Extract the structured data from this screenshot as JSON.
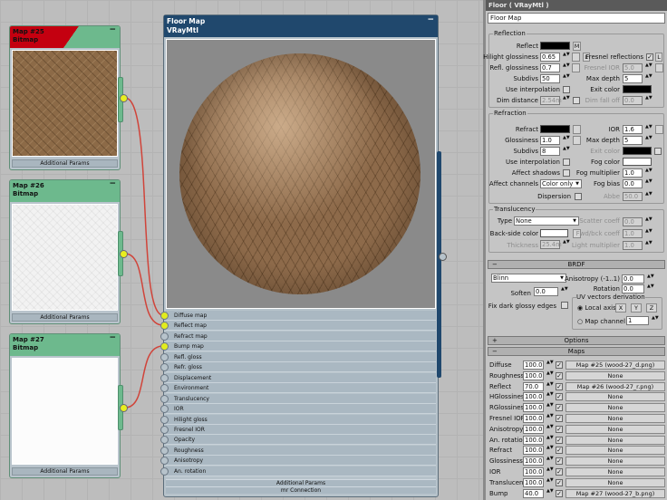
{
  "nodes": [
    {
      "title": "Map #25",
      "type": "Bitmap",
      "footer": "Additional Params",
      "selected": true,
      "texture": "wood"
    },
    {
      "title": "Map #26",
      "type": "Bitmap",
      "footer": "Additional Params",
      "selected": false,
      "texture": "white"
    },
    {
      "title": "Map #27",
      "type": "Bitmap",
      "footer": "Additional Params",
      "selected": false,
      "texture": "plain"
    }
  ],
  "material": {
    "name": "Floor Map",
    "type": "VRayMtl",
    "slots": [
      {
        "label": "Diffuse map",
        "connected": true
      },
      {
        "label": "Reflect map",
        "connected": true
      },
      {
        "label": "Refract map",
        "connected": false
      },
      {
        "label": "Bump map",
        "connected": true
      },
      {
        "label": "Refl. gloss",
        "connected": false
      },
      {
        "label": "Refr. gloss",
        "connected": false
      },
      {
        "label": "Displacement",
        "connected": false
      },
      {
        "label": "Environment",
        "connected": false
      },
      {
        "label": "Translucency",
        "connected": false
      },
      {
        "label": "IOR",
        "connected": false
      },
      {
        "label": "Hilight gloss",
        "connected": false
      },
      {
        "label": "Fresnel IOR",
        "connected": false
      },
      {
        "label": "Opacity",
        "connected": false
      },
      {
        "label": "Roughness",
        "connected": false
      },
      {
        "label": "Anisotropy",
        "connected": false
      },
      {
        "label": "An. rotation",
        "connected": false
      }
    ],
    "footer1": "Additional Params",
    "footer2": "mr Connection"
  },
  "panel": {
    "title": "Floor  ( VRayMtl )",
    "name": "Floor Map",
    "reflection": {
      "group": "Reflection",
      "reflect": "Reflect",
      "m": "M",
      "hilight": "Hilight glossiness",
      "hilight_v": "0.65",
      "l": "L",
      "fresnel": "Fresnel reflections",
      "refl_gloss": "Refl. glossiness",
      "refl_gloss_v": "0.7",
      "fresnel_ior": "Fresnel IOR",
      "fresnel_ior_v": "5.0",
      "subdivs": "Subdivs",
      "subdivs_v": "50",
      "max_depth": "Max depth",
      "max_depth_v": "5",
      "use_interp": "Use interpolation",
      "exit_color": "Exit color",
      "dim_distance": "Dim distance",
      "dim_distance_v": "2.54m",
      "dim_falloff": "Dim fall off",
      "dim_falloff_v": "0.0"
    },
    "refraction": {
      "group": "Refraction",
      "refract": "Refract",
      "ior": "IOR",
      "ior_v": "1.6",
      "glossiness": "Glossiness",
      "glossiness_v": "1.0",
      "max_depth": "Max depth",
      "max_depth_v": "5",
      "subdivs": "Subdivs",
      "subdivs_v": "8",
      "exit_color": "Exit color",
      "use_interp": "Use interpolation",
      "fog_color": "Fog color",
      "affect_shadows": "Affect shadows",
      "fog_mult": "Fog multiplier",
      "fog_mult_v": "1.0",
      "affect_channels": "Affect channels",
      "affect_channels_v": "Color only",
      "fog_bias": "Fog bias",
      "fog_bias_v": "0.0",
      "dispersion": "Dispersion",
      "abbe": "Abbe",
      "abbe_v": "50.0"
    },
    "translucency": {
      "group": "Translucency",
      "type": "Type",
      "type_v": "None",
      "scatter": "Scatter coeff",
      "scatter_v": "0.0",
      "backside": "Back-side color",
      "fwdbck": "Fwd/bck coeff",
      "fwdbck_v": "1.0",
      "thickness": "Thickness",
      "thickness_v": "25.4m",
      "light_mult": "Light multiplier",
      "light_mult_v": "1.0"
    },
    "brdf": {
      "bar": "BRDF",
      "type_v": "Blinn",
      "aniso": "Anisotropy (-1..1)",
      "aniso_v": "0.0",
      "rotation": "Rotation",
      "rotation_v": "0.0",
      "soften": "Soften",
      "soften_v": "0.0",
      "uv_group": "UV vectors derivation",
      "local_axis": "Local axis",
      "x": "X",
      "y": "Y",
      "z": "Z",
      "map_channel": "Map channel",
      "map_channel_v": "1",
      "fix_dark": "Fix dark glossy edges"
    },
    "options_bar": "Options",
    "maps_bar": "Maps",
    "maps": [
      {
        "label": "Diffuse",
        "amount": "100.0",
        "map": "Map #25 (wood-27_d.png)"
      },
      {
        "label": "Roughness",
        "amount": "100.0",
        "map": "None"
      },
      {
        "label": "Reflect",
        "amount": "70.0",
        "map": "Map #26 (wood-27_r.png)"
      },
      {
        "label": "HGlossiness",
        "amount": "100.0",
        "map": "None"
      },
      {
        "label": "RGlossiness",
        "amount": "100.0",
        "map": "None"
      },
      {
        "label": "Fresnel IOR",
        "amount": "100.0",
        "map": "None"
      },
      {
        "label": "Anisotropy",
        "amount": "100.0",
        "map": "None"
      },
      {
        "label": "An. rotation",
        "amount": "100.0",
        "map": "None"
      },
      {
        "label": "Refract",
        "amount": "100.0",
        "map": "None"
      },
      {
        "label": "Glossiness",
        "amount": "100.0",
        "map": "None"
      },
      {
        "label": "IOR",
        "amount": "100.0",
        "map": "None"
      },
      {
        "label": "Translucent",
        "amount": "100.0",
        "map": "None"
      },
      {
        "label": "Bump",
        "amount": "40.0",
        "map": "Map #27 (wood-27_b.png)"
      }
    ]
  },
  "colors": {
    "selected_header": "#c40010",
    "node_header": "#6db98d",
    "material_header": "#20486d",
    "wire": "#d0443a",
    "slot_connected": "#e2ec1e"
  }
}
